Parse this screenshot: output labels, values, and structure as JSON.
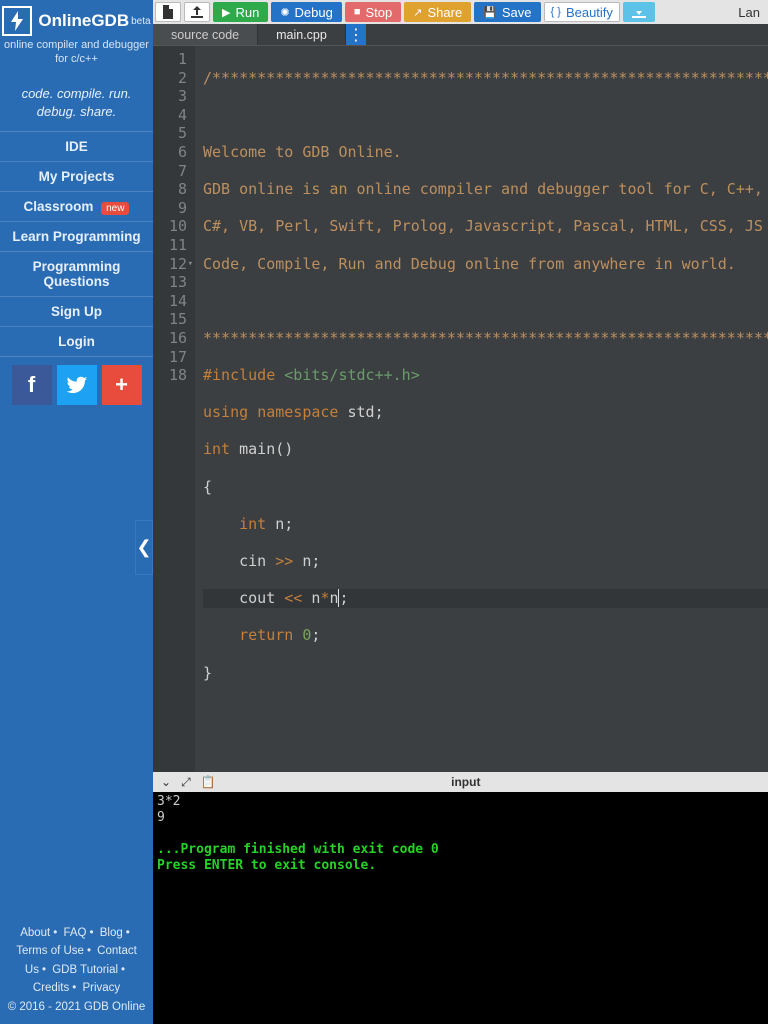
{
  "brand": {
    "name": "OnlineGDB",
    "beta": "beta",
    "subtitle": "online compiler and debugger for c/c++",
    "tagline1": "code. compile. run.",
    "tagline2": "debug. share."
  },
  "nav": {
    "ide": "IDE",
    "projects": "My Projects",
    "classroom": "Classroom",
    "new_badge": "new",
    "learn": "Learn Programming",
    "questions": "Programming Questions",
    "signup": "Sign Up",
    "login": "Login"
  },
  "social": {
    "fb": "f",
    "tw": "",
    "plus": "+"
  },
  "footer": {
    "about": "About",
    "faq": "FAQ",
    "blog": "Blog",
    "terms": "Terms of Use",
    "contact": "Contact Us",
    "tutorial": "GDB Tutorial",
    "credits": "Credits",
    "privacy": "Privacy",
    "copyright": "© 2016 - 2021 GDB Online"
  },
  "toolbar": {
    "run": "Run",
    "debug": "Debug",
    "stop": "Stop",
    "share": "Share",
    "save": "Save",
    "beautify": "Beautify",
    "lang": "Lan"
  },
  "tabs": {
    "src": "source code",
    "file": "main.cpp"
  },
  "code": {
    "l1": "/******************************************************************************",
    "l2": "",
    "l3": "Welcome to GDB Online.",
    "l4": "GDB online is an online compiler and debugger tool for C, C++,",
    "l5": "C#, VB, Perl, Swift, Prolog, Javascript, Pascal, HTML, CSS, JS",
    "l6": "Code, Compile, Run and Debug online from anywhere in world.",
    "l7": "",
    "l8": "*******************************************************************************",
    "include_kw": "#include",
    "include_val": "<bits/stdc++.h>",
    "using": "using",
    "namespace": "namespace",
    "std": "std",
    "int": "int",
    "main": "main()",
    "n": "n",
    "cin": "cin",
    "cout": "cout",
    "return": "return",
    "zero": "0",
    "rshift": ">>",
    "lshift": "<<",
    "star": "*"
  },
  "lines": [
    "1",
    "2",
    "3",
    "4",
    "5",
    "6",
    "7",
    "8",
    "9",
    "10",
    "11",
    "12",
    "13",
    "14",
    "15",
    "16",
    "17",
    "18"
  ],
  "terminal": {
    "title": "input",
    "l1": "3*2",
    "l2": "9",
    "l3": "",
    "l4": "...Program finished with exit code 0",
    "l5": "Press ENTER to exit console."
  }
}
